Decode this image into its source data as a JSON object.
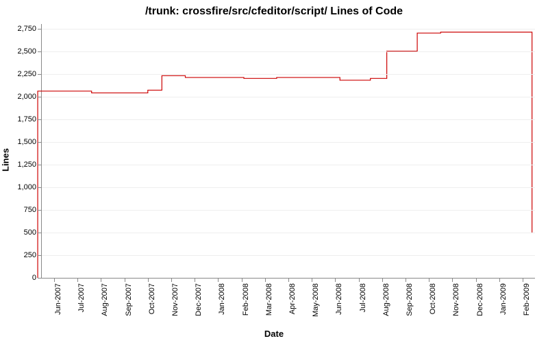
{
  "chart_data": {
    "type": "line",
    "title": "/trunk: crossfire/src/cfeditor/script/ Lines of Code",
    "xlabel": "Date",
    "ylabel": "Lines",
    "ylim": [
      0,
      2800
    ],
    "y_ticks": [
      0,
      250,
      500,
      750,
      1000,
      1250,
      1500,
      1750,
      2000,
      2250,
      2500,
      2750
    ],
    "x_categories": [
      "Jun-2007",
      "Jul-2007",
      "Aug-2007",
      "Sep-2007",
      "Oct-2007",
      "Nov-2007",
      "Dec-2007",
      "Jan-2008",
      "Feb-2008",
      "Mar-2008",
      "Apr-2008",
      "May-2008",
      "Jun-2008",
      "Jul-2008",
      "Aug-2008",
      "Sep-2008",
      "Oct-2008",
      "Nov-2008",
      "Dec-2008",
      "Jan-2009",
      "Feb-2009"
    ],
    "series": [
      {
        "name": "Lines of Code",
        "color": "#cc0000",
        "points": [
          {
            "x": -0.7,
            "y": 0
          },
          {
            "x": -0.7,
            "y": 2060
          },
          {
            "x": 1.6,
            "y": 2060
          },
          {
            "x": 1.6,
            "y": 2040
          },
          {
            "x": 4.0,
            "y": 2040
          },
          {
            "x": 4.0,
            "y": 2070
          },
          {
            "x": 4.6,
            "y": 2070
          },
          {
            "x": 4.6,
            "y": 2230
          },
          {
            "x": 5.6,
            "y": 2230
          },
          {
            "x": 5.6,
            "y": 2210
          },
          {
            "x": 8.1,
            "y": 2210
          },
          {
            "x": 8.1,
            "y": 2200
          },
          {
            "x": 9.5,
            "y": 2200
          },
          {
            "x": 9.5,
            "y": 2210
          },
          {
            "x": 12.2,
            "y": 2210
          },
          {
            "x": 12.2,
            "y": 2180
          },
          {
            "x": 13.5,
            "y": 2180
          },
          {
            "x": 13.5,
            "y": 2200
          },
          {
            "x": 14.2,
            "y": 2200
          },
          {
            "x": 14.2,
            "y": 2500
          },
          {
            "x": 15.5,
            "y": 2500
          },
          {
            "x": 15.5,
            "y": 2700
          },
          {
            "x": 16.5,
            "y": 2700
          },
          {
            "x": 16.5,
            "y": 2710
          },
          {
            "x": 20.4,
            "y": 2710
          },
          {
            "x": 20.4,
            "y": 500
          }
        ]
      }
    ]
  }
}
